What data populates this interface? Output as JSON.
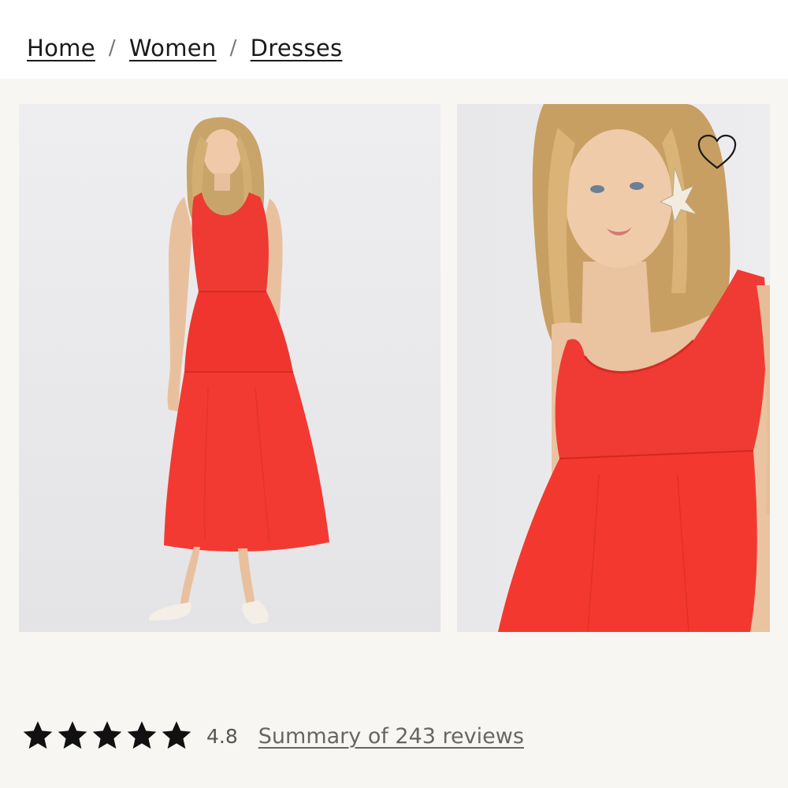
{
  "breadcrumb": {
    "items": [
      "Home",
      "Women",
      "Dresses"
    ],
    "separator": "/"
  },
  "gallery": {
    "images": [
      {
        "alt": "model-full-length",
        "background": "#ebebed"
      },
      {
        "alt": "model-close-up",
        "background": "#ebebed"
      }
    ],
    "dress_color": "#f0352f",
    "wishlist_icon": "heart-outline-icon"
  },
  "rating": {
    "stars": 5,
    "value": "4.8",
    "reviews_link": "Summary of 243 reviews",
    "star_color": "#111111"
  }
}
